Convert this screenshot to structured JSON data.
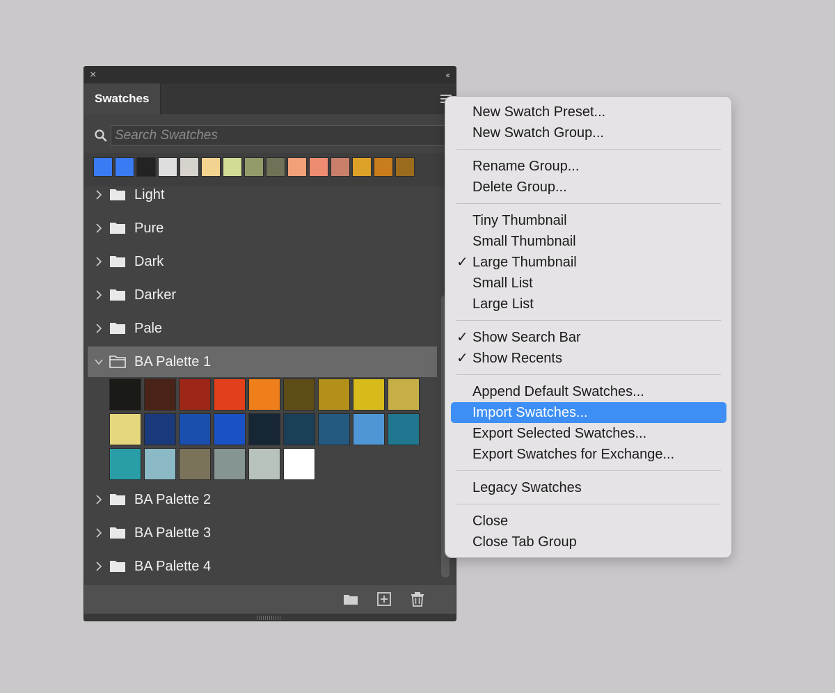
{
  "panel": {
    "close_glyph": "×",
    "collapse_glyph": "‹‹",
    "tab_label": "Swatches",
    "search_placeholder": "Search Swatches",
    "recent_swatches": [
      "#3a7af3",
      "#3a7af3",
      "#232323",
      "#dedede",
      "#d6d2cc",
      "#f2d38f",
      "#d2dc95",
      "#949b6b",
      "#6f7257",
      "#f2a077",
      "#ee8c72",
      "#c8806a",
      "#dea127",
      "#c87c1c",
      "#9b6b1e"
    ],
    "groups": [
      {
        "label": "Light",
        "expanded": false
      },
      {
        "label": "Pure",
        "expanded": false
      },
      {
        "label": "Dark",
        "expanded": false
      },
      {
        "label": "Darker",
        "expanded": false
      },
      {
        "label": "Pale",
        "expanded": false
      },
      {
        "label": "BA Palette 1",
        "expanded": true
      },
      {
        "label": "BA Palette 2",
        "expanded": false
      },
      {
        "label": "BA Palette 3",
        "expanded": false
      },
      {
        "label": "BA Palette 4",
        "expanded": false
      }
    ],
    "palette1_swatches": [
      "#1a1a17",
      "#4a2318",
      "#9c2718",
      "#e2401a",
      "#ee7f1a",
      "#5e4c17",
      "#b2901a",
      "#d7bb1a",
      "#c6b046",
      "#e5d77d",
      "#1b3a7b",
      "#1b4fae",
      "#1a52c6",
      "#162634",
      "#1c3f58",
      "#245a80",
      "#4f97d4",
      "#1f7890",
      "#2a9ea6",
      "#8bbac6",
      "#7a7259",
      "#849592",
      "#b7c2bc",
      "#ffffff"
    ],
    "footer_icons": [
      "folder-icon",
      "add-swatch-icon",
      "trash-icon"
    ]
  },
  "menu": {
    "items": [
      {
        "label": "New Swatch Preset...",
        "checked": false,
        "highlighted": false
      },
      {
        "label": "New Swatch Group...",
        "checked": false,
        "highlighted": false
      },
      {
        "separator": true
      },
      {
        "label": "Rename Group...",
        "checked": false,
        "highlighted": false
      },
      {
        "label": "Delete Group...",
        "checked": false,
        "highlighted": false
      },
      {
        "separator": true
      },
      {
        "label": "Tiny Thumbnail",
        "checked": false,
        "highlighted": false
      },
      {
        "label": "Small Thumbnail",
        "checked": false,
        "highlighted": false
      },
      {
        "label": "Large Thumbnail",
        "checked": true,
        "highlighted": false
      },
      {
        "label": "Small List",
        "checked": false,
        "highlighted": false
      },
      {
        "label": "Large List",
        "checked": false,
        "highlighted": false
      },
      {
        "separator": true
      },
      {
        "label": "Show Search Bar",
        "checked": true,
        "highlighted": false
      },
      {
        "label": "Show Recents",
        "checked": true,
        "highlighted": false
      },
      {
        "separator": true
      },
      {
        "label": "Append Default Swatches...",
        "checked": false,
        "highlighted": false
      },
      {
        "label": "Import Swatches...",
        "checked": false,
        "highlighted": true
      },
      {
        "label": "Export Selected Swatches...",
        "checked": false,
        "highlighted": false
      },
      {
        "label": "Export Swatches for Exchange...",
        "checked": false,
        "highlighted": false
      },
      {
        "separator": true
      },
      {
        "label": "Legacy Swatches",
        "checked": false,
        "highlighted": false
      },
      {
        "separator": true
      },
      {
        "label": "Close",
        "checked": false,
        "highlighted": false
      },
      {
        "label": "Close Tab Group",
        "checked": false,
        "highlighted": false
      }
    ],
    "check_glyph": "✓",
    "highlight_color": "#3d8ff5"
  }
}
